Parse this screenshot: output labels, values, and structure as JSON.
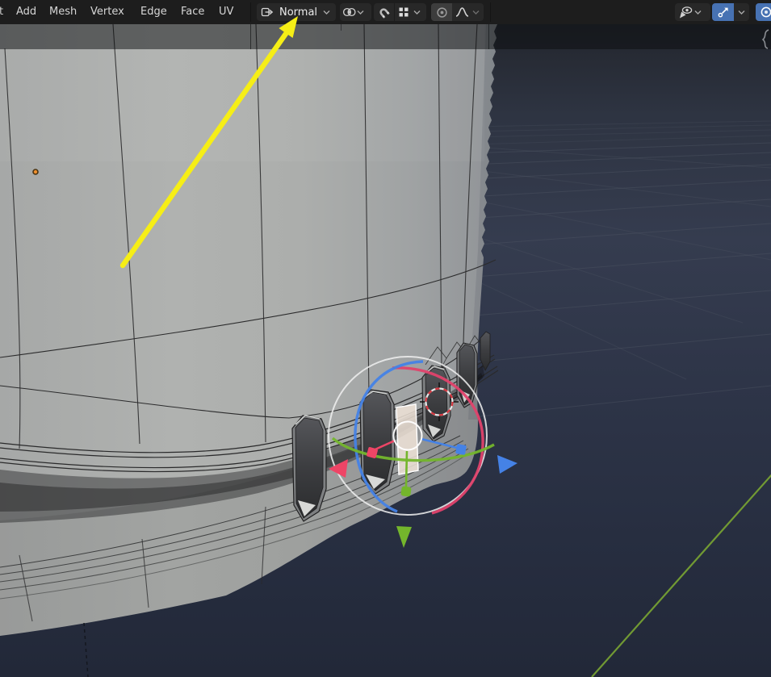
{
  "header": {
    "clipped_left_text": "t",
    "menus": [
      "Add",
      "Mesh",
      "Vertex",
      "Edge",
      "Face",
      "UV"
    ],
    "transform_orientation": {
      "label": "Normal"
    }
  },
  "icons": {
    "transform_orientation": "orientation-box-arrow-icon",
    "pivot_point": "pivot-point-icon",
    "snap_toggle": "magnet-icon",
    "snap_with": "snap-increment-grid-icon",
    "proportional_editing": "proportional-circle-icon",
    "proportional_falloff": "smooth-falloff-curve-icon",
    "object_visibility": "eye-pointer-icon",
    "show_gizmos": "gizmo-arrow-icon",
    "show_overlays": "overlays-circle-icon",
    "sidebar_toggle": "sidebar-squiggle-icon"
  },
  "colors": {
    "header_bg": "#1d1d1d",
    "widget_bg": "#282828",
    "active_blue": "#4772b3",
    "axis_x": "#e0426b",
    "axis_y": "#74b62c",
    "axis_z": "#4582e6",
    "gizmo_white": "#f0f0f0",
    "annotation_yellow": "#f6ee16",
    "origin_orange": "#ef8f2e",
    "background_top": "#23262d",
    "background_mid": "#343b4e",
    "background_bottom": "#222838",
    "grid_line": "#4e5563",
    "y_axis_green": "#76a033",
    "mesh_fill": "#abadac",
    "wire": "#2b2b2c",
    "selected_face": "#f0e4d8"
  }
}
